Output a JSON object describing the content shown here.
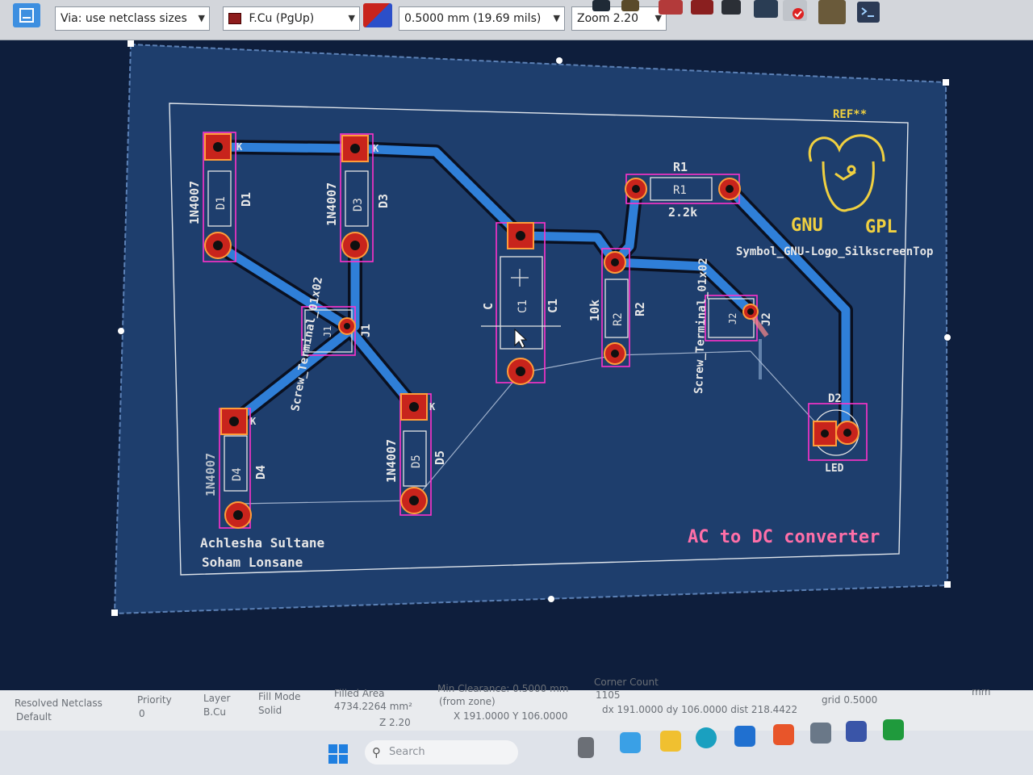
{
  "toolbar": {
    "via_size": "Via: use netclass sizes",
    "layer": "F.Cu (PgUp)",
    "track_width": "0.5000 mm (19.69 mils)",
    "zoom": "Zoom 2.20"
  },
  "pcb": {
    "diodes": [
      {
        "value": "1N4007",
        "ref": "D1",
        "ref_inner": "D1",
        "k": "K"
      },
      {
        "value": "1N4007",
        "ref": "D3",
        "ref_inner": "D3",
        "k": "K"
      },
      {
        "value": "1N4007",
        "ref": "D4",
        "ref_inner": "D4",
        "k": "K"
      },
      {
        "value": "1N4007",
        "ref": "D5",
        "ref_inner": "D5",
        "k": "K"
      }
    ],
    "j1": {
      "value": "Screw_Terminal_01x02",
      "ref": "J1",
      "ref_inner": "J1"
    },
    "j2": {
      "value": "Screw_Terminal_01x02",
      "ref": "J2",
      "ref_inner": "J2"
    },
    "c1": {
      "value": "C",
      "ref": "C1",
      "ref_inner": "C1"
    },
    "r1": {
      "ref": "R1",
      "ref_inner": "R1",
      "value": "2.2k"
    },
    "r2": {
      "ref": "R2",
      "ref_inner": "R2",
      "value": "10k"
    },
    "d2": {
      "ref": "D2",
      "value": "LED"
    },
    "logo": {
      "ref": "REF**",
      "left": "GNU",
      "right": "GPL",
      "name": "Symbol_GNU-Logo_SilkscreenTop"
    },
    "title": "AC to DC converter",
    "authors": [
      "Achlesha Sultane",
      "Soham Lonsane"
    ]
  },
  "status": {
    "netclass_label": "Resolved Netclass",
    "netclass_value": "Default",
    "priority_label": "Priority",
    "priority_value": "0",
    "layer_label": "Layer",
    "layer_value": "B.Cu",
    "fill_label": "Fill Mode",
    "fill_value": "Solid",
    "area_label": "Filled Area",
    "area_value": "4734.2264 mm²",
    "clearance_label": "Min Clearance: 0.5000 mm",
    "clearance_value": "(from zone)",
    "corner_label": "Corner Count",
    "corner_value": "1105",
    "z": "Z 2.20",
    "xy": "X 191.0000  Y 106.0000",
    "dxy": "dx 191.0000  dy 106.0000  dist 218.4422",
    "grid": "grid 0.5000",
    "units": "mm"
  },
  "taskbar": {
    "search_placeholder": "Search"
  },
  "colors": {
    "board": "#1d3c6a",
    "track": "#2f7fd8",
    "pad": "#c8241c",
    "silk": "#e6e6e6",
    "edge": "#dfe4ea",
    "title": "#ff6fa8",
    "logo": "#f0d040",
    "courtyard": "#ff33cc"
  }
}
